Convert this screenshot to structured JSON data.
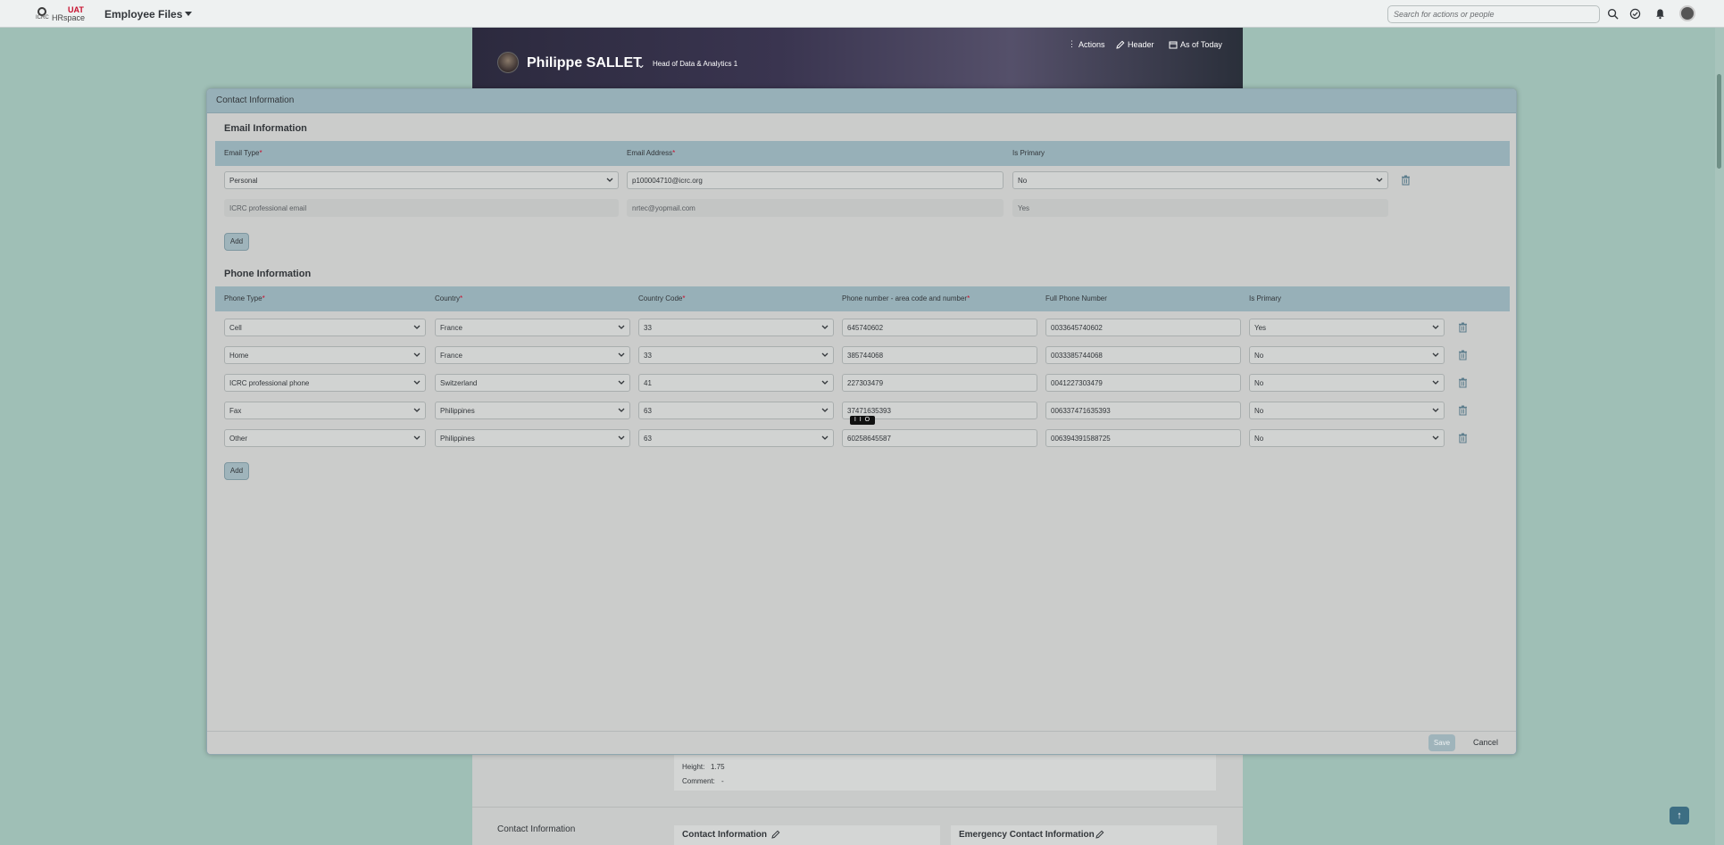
{
  "shell": {
    "logo_text": "ICRC",
    "logo_env": "UAT",
    "logo_app": "HRspace",
    "app_title": "Employee Files",
    "search_placeholder": "Search for actions or people"
  },
  "background": {
    "employee_name": "Philippe SALLET",
    "employee_title": "Head of Data & Analytics 1",
    "actions_label": "Actions",
    "header_label": "Header",
    "as_of_label": "As of Today",
    "height_label": "Height:",
    "height_value": "1.75",
    "comment_label": "Comment:",
    "comment_value": "-",
    "nav_contact": "Contact Information",
    "card_contact": "Contact Information",
    "card_emergency": "Emergency Contact Information"
  },
  "dialog": {
    "title": "Contact Information",
    "email_section": "Email Information",
    "email_headers": [
      "Email Type",
      "Email Address",
      "Is Primary"
    ],
    "email_rows": [
      {
        "type": "Personal",
        "address": "p100004710@icrc.org",
        "primary": "No",
        "editable": true
      },
      {
        "type": "ICRC professional email",
        "address": "nrtec@yopmail.com",
        "primary": "Yes",
        "editable": false
      }
    ],
    "phone_section": "Phone Information",
    "phone_headers": [
      "Phone Type",
      "Country",
      "Country Code",
      "Phone number - area code and number",
      "Full Phone Number",
      "Is Primary"
    ],
    "phone_rows": [
      {
        "type": "Cell",
        "country": "France",
        "code": "33",
        "number": "645740602",
        "full": "0033645740602",
        "primary": "Yes"
      },
      {
        "type": "Home",
        "country": "France",
        "code": "33",
        "number": "385744068",
        "full": "0033385744068",
        "primary": "No"
      },
      {
        "type": "ICRC professional phone",
        "country": "Switzerland",
        "code": "41",
        "number": "227303479",
        "full": "0041227303479",
        "primary": "No"
      },
      {
        "type": "Fax",
        "country": "Philippines",
        "code": "63",
        "number": "37471635393",
        "full": "006337471635393",
        "primary": "No"
      },
      {
        "type": "Other",
        "country": "Philippines",
        "code": "63",
        "number": "60258645587",
        "full": "006394391588725",
        "primary": "No"
      }
    ],
    "add_label": "Add",
    "save_label": "Save",
    "cancel_label": "Cancel",
    "cursor_badge": "I I O"
  }
}
